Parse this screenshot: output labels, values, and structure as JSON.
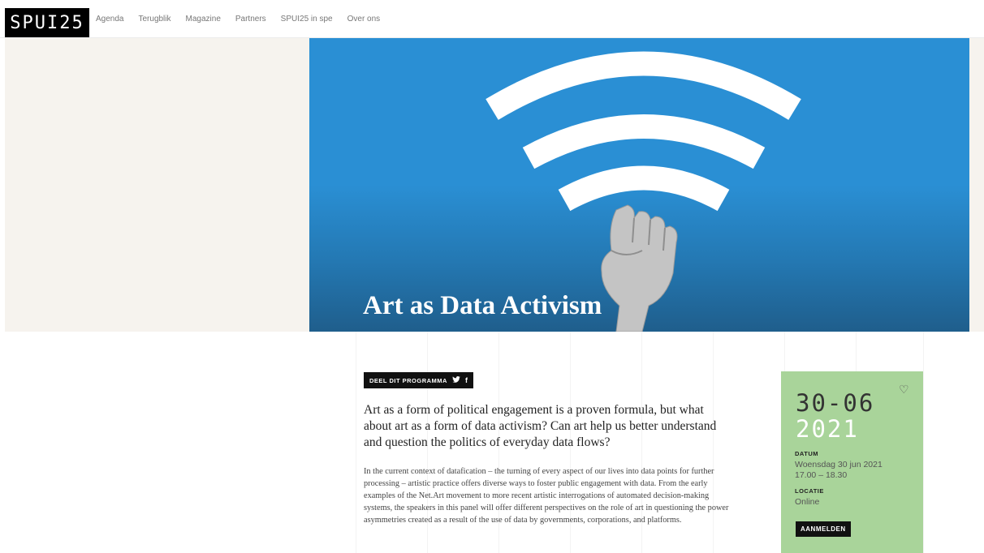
{
  "brand": {
    "logo_text": "SPUI25"
  },
  "nav": {
    "items": [
      "Agenda",
      "Terugblik",
      "Magazine",
      "Partners",
      "SPUI25 in spe",
      "Over ons"
    ]
  },
  "hero": {
    "title": "Art as Data Activism"
  },
  "share": {
    "label": "DEEL DIT PROGRAMMA",
    "twitter": "twitter-icon",
    "facebook": "f"
  },
  "intro": {
    "lead": "Art as a form of political engagement is a proven formula, but what about art as a form of data activism? Can art help us better understand and question the politics of everyday data flows?",
    "body": "In the current context of datafication – the turning of every aspect of our lives into data points for further processing – artistic practice offers diverse ways to foster public engagement with data. From the early examples of the Net.Art movement to more recent artistic interrogations of automated decision-making systems, the speakers in this panel will offer different perspectives on the role of art in questioning the power asymmetries created as a result of the use of data by governments, corporations, and platforms."
  },
  "event": {
    "date_day_month": "30-06",
    "date_year": "2021",
    "datum_label": "DATUM",
    "datum_value": "Woensdag 30 jun 2021",
    "time_value": "17.00 – 18.30",
    "locatie_label": "LOCATIE",
    "locatie_value": "Online",
    "register_label": "AANMELDEN",
    "card_color": "#a9d49a"
  },
  "colors": {
    "hero_blue": "#2a8fd4",
    "hero_bg": "#f6f3ee"
  }
}
